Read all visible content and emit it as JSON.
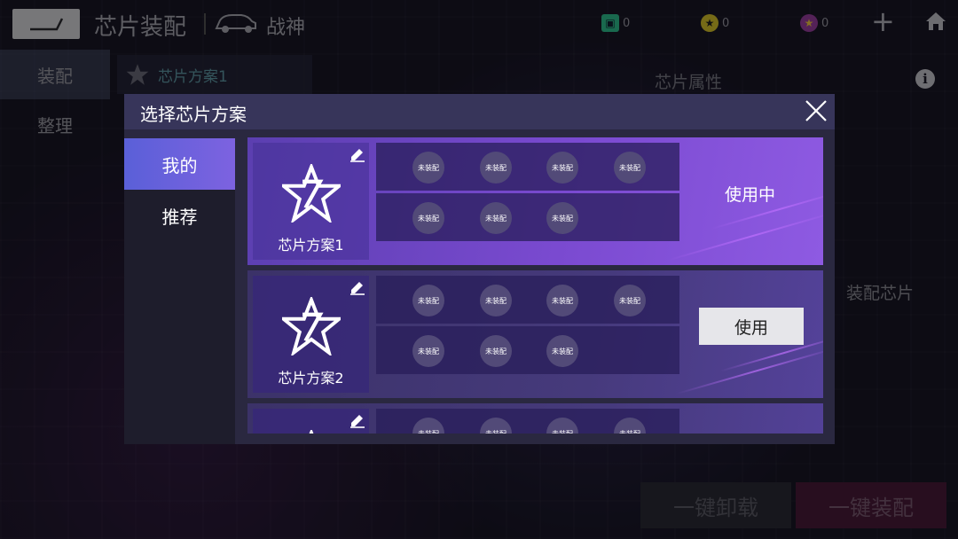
{
  "header": {
    "title": "芯片装配",
    "car_name": "战神",
    "currencies": [
      {
        "icon": "ticket-icon",
        "value": "0",
        "color": "#2fbf8f"
      },
      {
        "icon": "star-coin-icon",
        "value": "0",
        "color": "#d8c32a"
      },
      {
        "icon": "purple-star-coin-icon",
        "value": "0",
        "color": "#9a3fa0"
      }
    ]
  },
  "left_nav": {
    "items": [
      {
        "label": "装配"
      },
      {
        "label": "整理"
      }
    ]
  },
  "background": {
    "plan_tab_label": "芯片方案1",
    "attr_label": "芯片属性",
    "equip_chip_label": "装配芯片",
    "unload_all_label": "一键卸载",
    "equip_all_label": "一键装配"
  },
  "modal": {
    "title": "选择芯片方案",
    "tabs": [
      {
        "label": "我的"
      },
      {
        "label": "推荐"
      }
    ],
    "plans": [
      {
        "name": "芯片方案1",
        "slots_row1": [
          "未装配",
          "未装配",
          "未装配",
          "未装配"
        ],
        "slots_row2": [
          "未装配",
          "未装配",
          "未装配"
        ],
        "status_label": "使用中",
        "use_label": ""
      },
      {
        "name": "芯片方案2",
        "slots_row1": [
          "未装配",
          "未装配",
          "未装配",
          "未装配"
        ],
        "slots_row2": [
          "未装配",
          "未装配",
          "未装配"
        ],
        "status_label": "",
        "use_label": "使用"
      },
      {
        "name": "",
        "slots_row1": [
          "未装配",
          "未装配",
          "未装配",
          "未装配"
        ],
        "slots_row2": [],
        "status_label": "",
        "use_label": ""
      }
    ]
  }
}
